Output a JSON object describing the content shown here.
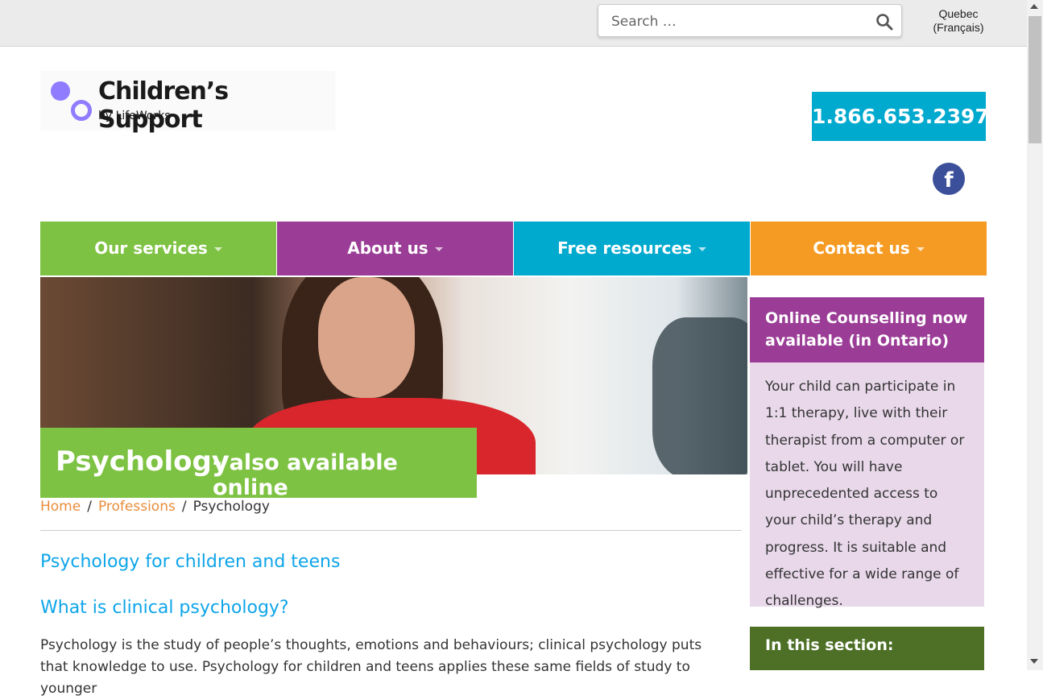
{
  "search": {
    "placeholder": "Search …"
  },
  "lang": {
    "line1": "Quebec",
    "line2": "(Français)"
  },
  "logo": {
    "title": "Children’s Support",
    "subtitle": "by LifeWorks"
  },
  "phone": "1.866.653.2397",
  "social": {
    "facebook_glyph": "f"
  },
  "nav": [
    {
      "label": "Our services",
      "color": "#7dc242"
    },
    {
      "label": "About us",
      "color": "#9b3d96"
    },
    {
      "label": "Free resources",
      "color": "#00a9ce"
    },
    {
      "label": "Contact us",
      "color": "#f59b23"
    }
  ],
  "hero": {
    "title": "Psychology",
    "subtitle": "- also available online"
  },
  "breadcrumb": {
    "home": "Home",
    "sep1": "/",
    "professions": "Professions",
    "sep2": "/",
    "current": "Psychology"
  },
  "content": {
    "h1": "Psychology for children and teens",
    "h2": "What is clinical psychology?",
    "paragraph": "Psychology is the study of people’s thoughts, emotions and behaviours; clinical psychology puts that knowledge to use. Psychology for children and teens applies these same fields of study to younger"
  },
  "sidebar": {
    "callout_title": "Online Counselling now available (in Ontario)",
    "callout_body": "Your child can participate in 1:1 therapy, live with their therapist from a computer or tablet. You will have unprecedented access to your child’s therapy and progress. It is suitable and effective for a wide range of challenges.",
    "section_title": "In this section:"
  }
}
